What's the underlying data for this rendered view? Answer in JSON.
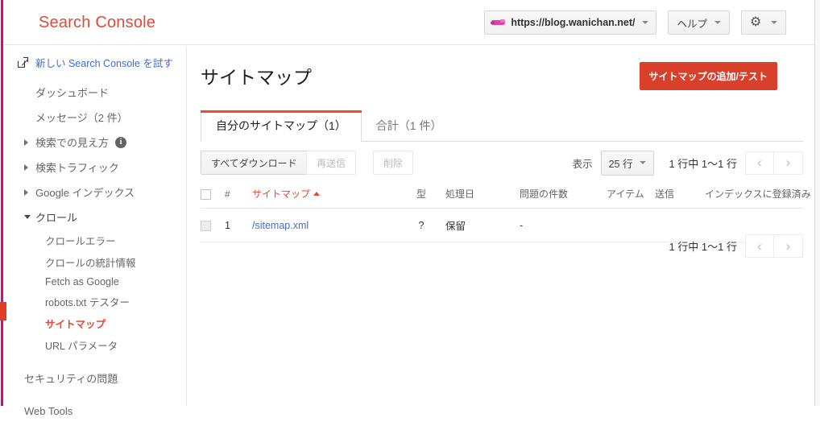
{
  "header": {
    "brand": "Search Console",
    "site_selector": {
      "icon": "site-favicon-crocodile",
      "url": "https://blog.wanichan.net/",
      "caret": "chevron-down-icon"
    },
    "help_label": "ヘルプ",
    "settings_icon": "gear-icon"
  },
  "sidebar": {
    "try_new_link": {
      "icon": "external-link-icon",
      "label": "新しい Search Console を試す"
    },
    "items": [
      {
        "label": "ダッシュボード",
        "type": "top"
      },
      {
        "label": "メッセージ（2 件）",
        "type": "top"
      },
      {
        "label": "検索での見え方",
        "type": "expandable",
        "open": false,
        "info_icon": "info-icon"
      },
      {
        "label": "検索トラフィック",
        "type": "expandable",
        "open": false
      },
      {
        "label": "Google インデックス",
        "type": "expandable",
        "open": false
      },
      {
        "label": "クロール",
        "type": "expandable",
        "open": true
      }
    ],
    "crawl_children": [
      {
        "label": "クロールエラー",
        "active": false
      },
      {
        "label": "クロールの統計情報",
        "active": false
      },
      {
        "label": "Fetch as Google",
        "active": false
      },
      {
        "label": "robots.txt テスター",
        "active": false
      },
      {
        "label": "サイトマップ",
        "active": true
      },
      {
        "label": "URL パラメータ",
        "active": false
      }
    ],
    "bottom_items": [
      {
        "label": "セキュリティの問題"
      },
      {
        "label": "Web Tools"
      }
    ]
  },
  "main": {
    "page_title": "サイトマップ",
    "add_button": "サイトマップの追加/テスト",
    "tabs": [
      {
        "label": "自分のサイトマップ（1）",
        "active": true
      },
      {
        "label": "合計（1 件）",
        "active": false
      }
    ],
    "toolbar": {
      "download_all": "すべてダウンロード",
      "resend": "再送信",
      "delete": "削除"
    },
    "pager": {
      "show_label": "表示",
      "rows_value": "25 行",
      "rows_caret": "chevron-down-icon",
      "range": "1 行中 1〜1 行",
      "prev_icon": "chevron-left-icon",
      "next_icon": "chevron-right-icon"
    },
    "table": {
      "headers": {
        "select_all": "select-all-checkbox",
        "num": "#",
        "sitemap": "サイトマップ",
        "sitemap_sort": "ascending",
        "type": "型",
        "processed": "処理日",
        "issues": "問題の件数",
        "items": "アイテム",
        "submitted": "送信",
        "indexed": "インデックスに登録済み"
      },
      "rows": [
        {
          "num": "1",
          "sitemap": "/sitemap.xml",
          "type": "?",
          "processed": "保留",
          "issues": "-",
          "items": "",
          "submitted": "",
          "indexed": ""
        }
      ]
    }
  },
  "colors": {
    "brand_red": "#dd4b39",
    "button_red": "#d9402c",
    "tab_accent": "#e8512f",
    "link_blue": "#3b6fd4",
    "edge_pink": "#e6007e",
    "active_marker": "#e03e2a"
  }
}
